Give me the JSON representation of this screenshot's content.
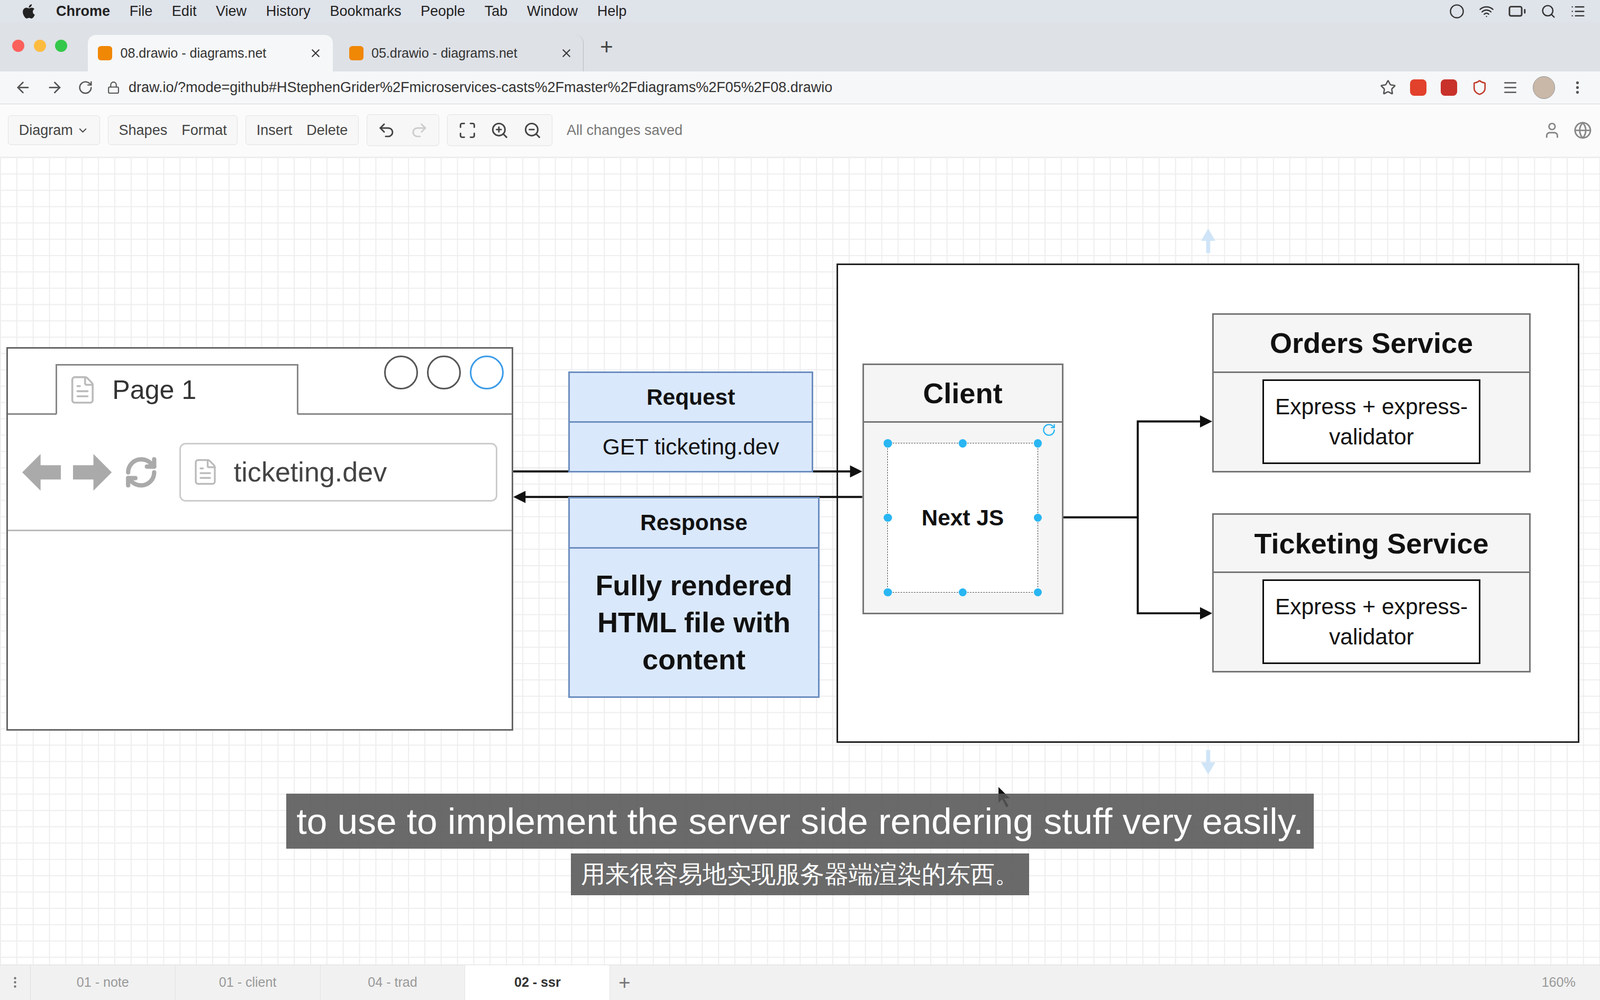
{
  "menu_bar": {
    "app": "Chrome",
    "items": [
      "File",
      "Edit",
      "View",
      "History",
      "Bookmarks",
      "People",
      "Tab",
      "Window",
      "Help"
    ]
  },
  "browser_tabs": [
    {
      "label": "08.drawio - diagrams.net",
      "selected": true
    },
    {
      "label": "05.drawio - diagrams.net",
      "selected": false
    }
  ],
  "new_tab": "+",
  "address": "draw.io/?mode=github#HStephenGrider%2Fmicroservices-casts%2Fmaster%2Fdiagrams%2F05%2F08.drawio",
  "toolbar": {
    "diagram_menu": "Diagram",
    "groups": [
      [
        "Shapes",
        "Format"
      ],
      [
        "Insert",
        "Delete"
      ]
    ],
    "status": "All changes saved"
  },
  "diagram": {
    "browser_mock": {
      "tab": "Page 1",
      "url": "ticketing.dev",
      "window_buttons": [
        {
          "highlighted": false
        },
        {
          "highlighted": false
        },
        {
          "highlighted": true
        }
      ]
    },
    "request": {
      "title": "Request",
      "body": "GET ticketing.dev"
    },
    "response": {
      "title": "Response",
      "body": "Fully rendered HTML file with content"
    },
    "client": {
      "title": "Client",
      "inner": "Next JS",
      "selected": true
    },
    "services": [
      {
        "title": "Orders Service",
        "inner": "Express + express-validator"
      },
      {
        "title": "Ticketing Service",
        "inner": "Express + express-validator"
      }
    ]
  },
  "subtitles": {
    "english": "to use to implement the server side rendering stuff very easily.",
    "chinese": "用来很容易地实现服务器端渲染的东西。"
  },
  "pages": [
    {
      "label": "01 - note",
      "selected": false
    },
    {
      "label": "01 - client",
      "selected": false
    },
    {
      "label": "04 - trad",
      "selected": false
    },
    {
      "label": "02 - ssr",
      "selected": true
    }
  ],
  "add_page": "+",
  "zoom": "160%"
}
